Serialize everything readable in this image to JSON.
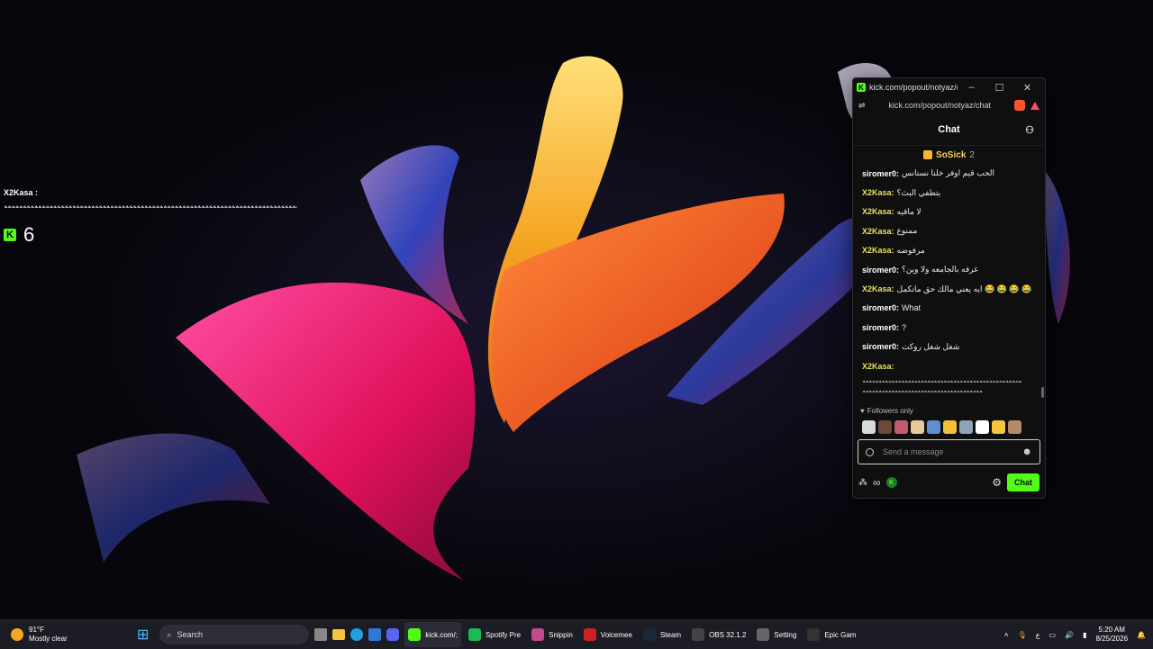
{
  "overlay": {
    "username": "X2Kasa :",
    "message": "ﻪﻪﻪﻪﻪﻪﻪﻪﻪﻪﻪﻪﻪﻪﻪﻪﻪﻪﻪﻪﻪﻪﻪﻪﻪﻪﻪﻪﻪﻪﻪﻪﻪﻪﻪﻪﻪﻪﻪﻪﻪﻪﻪﻪﻪﻪﻪﻪﻪﻪﻪﻪﻪﻪﻪﻪﻪﻪﻪﻪﻪﻪﻪﻪﻪﻪﻪﻪﻪﻪﻪﻪﻪﻪﻪﻪﻪﻪﻪﻪﻪﻪﻪﻪﻪ",
    "count": "6"
  },
  "window": {
    "title": "kick.com/popout/notyaz/ch...",
    "url": "kick.com/popout/notyaz/chat"
  },
  "chat": {
    "header": "Chat",
    "pinned_user": "SoSick",
    "pinned_count": "2",
    "messages": [
      {
        "user": "siromer0:",
        "text": "الحب قيم اوفر خلنا نستانس",
        "kind": "siromer"
      },
      {
        "user": "X2Kasa:",
        "text": "يتطفي البث؟",
        "kind": "x2kasa"
      },
      {
        "user": "X2Kasa:",
        "text": "لا ماقيه",
        "kind": "x2kasa"
      },
      {
        "user": "X2Kasa:",
        "text": "ممنوع",
        "kind": "x2kasa"
      },
      {
        "user": "X2Kasa:",
        "text": "مرفوضه",
        "kind": "x2kasa"
      },
      {
        "user": "siromer0:",
        "text": "غرفه بالجامعه ولا وين؟",
        "kind": "siromer"
      },
      {
        "user": "X2Kasa:",
        "text": "ايه يعني مالك حق ماتكمل 😂 😂 😂 😂",
        "kind": "x2kasa"
      },
      {
        "user": "siromer0:",
        "text": "What",
        "kind": "siromer"
      },
      {
        "user": "siromer0:",
        "text": "?",
        "kind": "siromer"
      },
      {
        "user": "siromer0:",
        "text": "شغل شغل روكت",
        "kind": "siromer"
      },
      {
        "user": "X2Kasa:",
        "text": "",
        "kind": "x2kasa"
      }
    ],
    "long_line_1": "ﻪﻪﻪﻪﻪﻪﻪﻪﻪﻪﻪﻪﻪﻪﻪﻪﻪﻪﻪﻪﻪﻪﻪﻪﻪﻪﻪﻪﻪﻪﻪﻪﻪﻪﻪﻪﻪﻪﻪﻪﻪﻪﻪﻪﻪﻪﻪﻪﻪ",
    "long_line_2": "ﻪﻪﻪﻪﻪﻪﻪﻪﻪﻪﻪﻪﻪﻪﻪﻪﻪﻪﻪﻪﻪﻪﻪﻪﻪﻪﻪﻪﻪﻪﻪﻪﻪﻪﻪﻪﻪ",
    "followers_only": "Followers only",
    "input_placeholder": "Send a message",
    "send_label": "Chat",
    "emote_colors": [
      "#d9d9d9",
      "#6b4a3a",
      "#c25b6d",
      "#e8c99a",
      "#5f8fcf",
      "#f2c037",
      "#8fa3b8",
      "#ffffff",
      "#f5c542",
      "#b38a6b"
    ]
  },
  "colors": {
    "kick_green": "#53fc18",
    "x2kasa_name": "#e7e25e",
    "siromer_name": "#ffffff"
  },
  "taskbar": {
    "weather_temp": "91°F",
    "weather_desc": "Mostly clear",
    "search_label": "Search",
    "apps": [
      {
        "label": "kick.com/;",
        "color": "#53fc18",
        "active": true
      },
      {
        "label": "Spotify Pre",
        "color": "#1db954",
        "active": false
      },
      {
        "label": "Snippin",
        "color": "#c04b8e",
        "active": false
      },
      {
        "label": "Voicemee",
        "color": "#c22",
        "active": false
      },
      {
        "label": "Steam",
        "color": "#1b2838",
        "active": false
      },
      {
        "label": "OBS 32.1.2",
        "color": "#444",
        "active": false
      },
      {
        "label": "Setting",
        "color": "#666",
        "active": false
      },
      {
        "label": "Epic Gam",
        "color": "#333",
        "active": false
      }
    ],
    "time": "5:20 AM",
    "date": "8/25/2026",
    "lang": "ع"
  }
}
